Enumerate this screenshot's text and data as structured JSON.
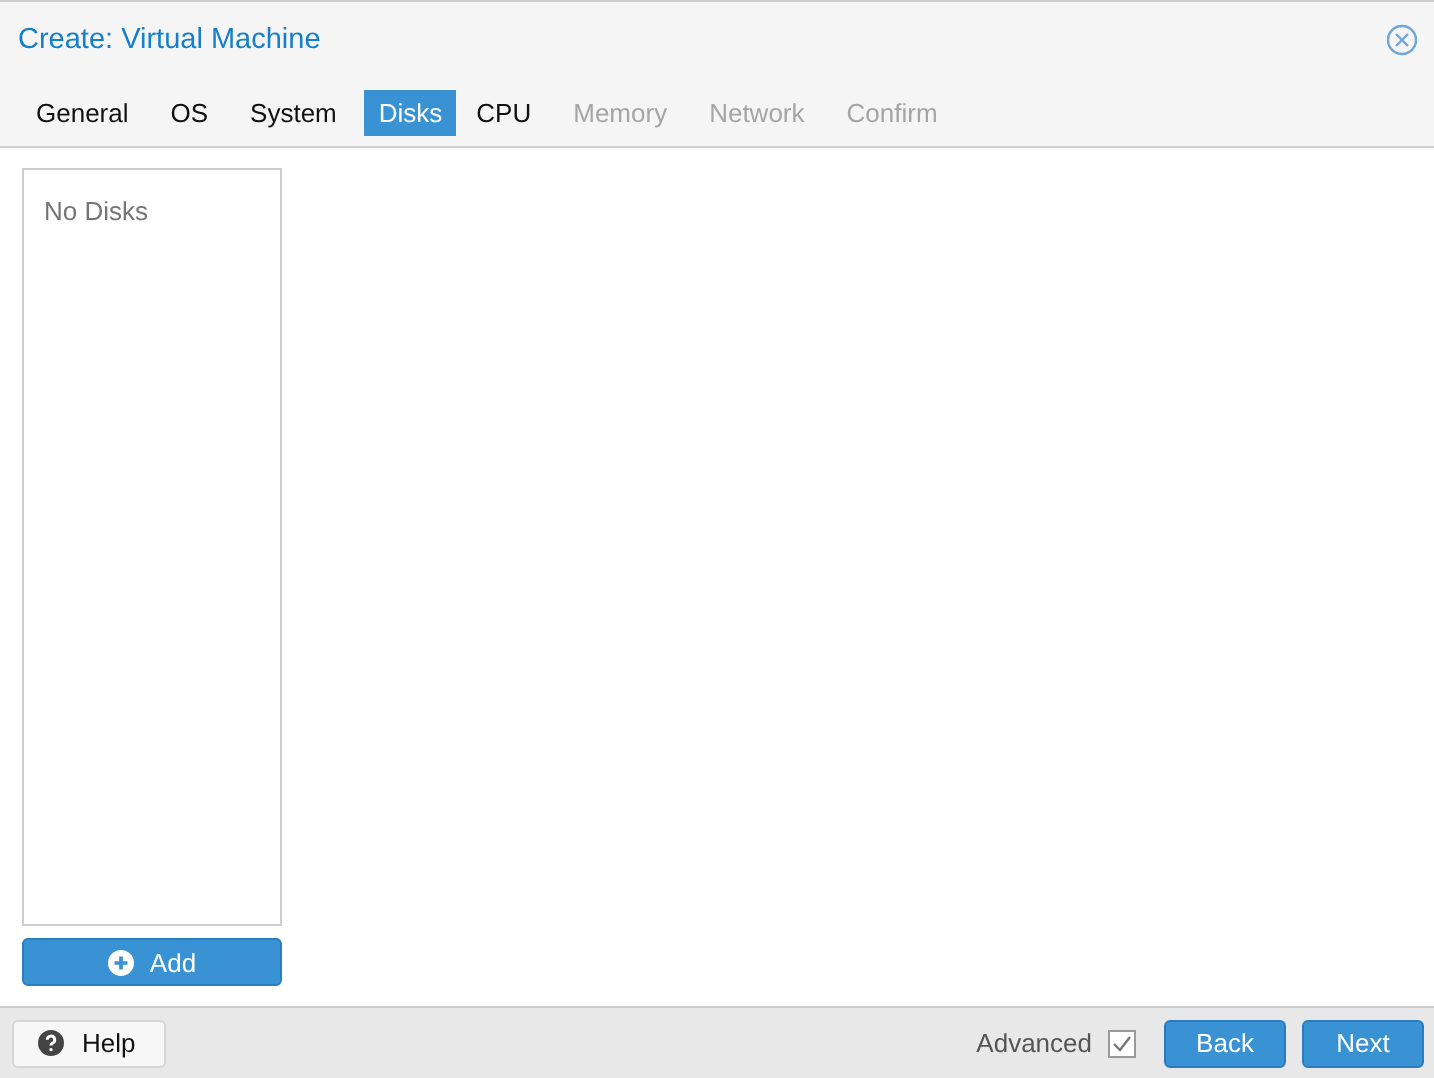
{
  "window": {
    "title": "Create: Virtual Machine"
  },
  "tabs": [
    {
      "label": "General",
      "selected": false,
      "disabled": false
    },
    {
      "label": "OS",
      "selected": false,
      "disabled": false
    },
    {
      "label": "System",
      "selected": false,
      "disabled": false
    },
    {
      "label": "Disks",
      "selected": true,
      "disabled": false
    },
    {
      "label": "CPU",
      "selected": false,
      "disabled": false
    },
    {
      "label": "Memory",
      "selected": false,
      "disabled": true
    },
    {
      "label": "Network",
      "selected": false,
      "disabled": true
    },
    {
      "label": "Confirm",
      "selected": false,
      "disabled": true
    }
  ],
  "disk_list": {
    "empty_text": "No Disks"
  },
  "add_button": {
    "label": "Add"
  },
  "footer": {
    "help": "Help",
    "advanced": {
      "label": "Advanced",
      "checked": true
    },
    "buttons": [
      "Back",
      "Next"
    ]
  }
}
